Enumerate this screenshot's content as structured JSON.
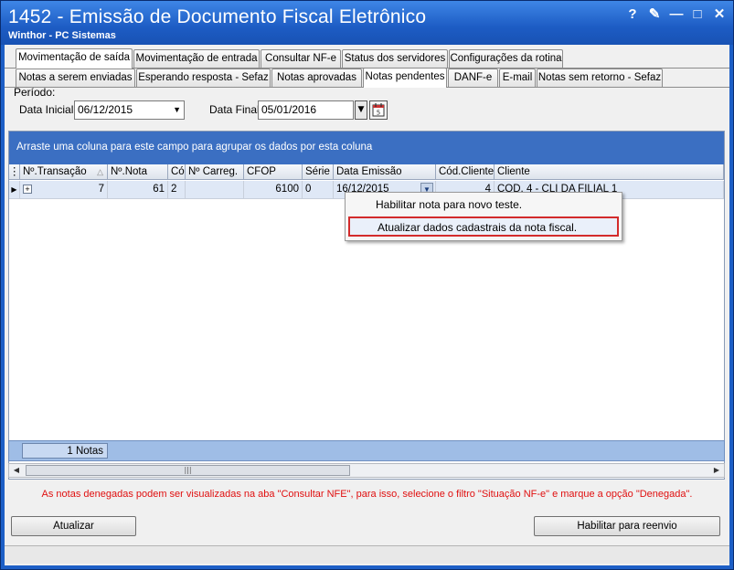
{
  "window": {
    "title": "1452 - Emissão de Documento Fiscal Eletrônico",
    "subtitle": "Winthor - PC Sistemas",
    "controls": [
      "?",
      "✎",
      "—",
      "□",
      "✕"
    ]
  },
  "tabs_top": [
    {
      "label": "Movimentação de saída",
      "active": true
    },
    {
      "label": "Movimentação de entrada",
      "active": false
    },
    {
      "label": "Consultar NF-e",
      "active": false
    },
    {
      "label": "Status dos servidores",
      "active": false
    },
    {
      "label": "Configurações da rotina",
      "active": false
    }
  ],
  "tabs_sub": [
    {
      "label": "Notas a serem enviadas",
      "active": false
    },
    {
      "label": "Esperando resposta - Sefaz",
      "active": false
    },
    {
      "label": "Notas aprovadas",
      "active": false
    },
    {
      "label": "Notas pendentes",
      "active": true
    },
    {
      "label": "DANF-e",
      "active": false
    },
    {
      "label": "E-mail",
      "active": false
    },
    {
      "label": "Notas sem retorno - Sefaz",
      "active": false
    }
  ],
  "period": {
    "label": "Período:",
    "start_label": "Data Inicial",
    "start_value": "06/12/2015",
    "end_label": "Data Final",
    "end_value": "05/01/2016"
  },
  "grid": {
    "group_hint": "Arraste uma coluna para este campo para agrupar os dados por esta coluna",
    "columns": [
      "Nº.Transação",
      "Nº.Nota",
      "Cód",
      "Nº Carreg.",
      "CFOP",
      "Série",
      "Data Emissão",
      "Cód.Cliente",
      "Cliente"
    ],
    "row": {
      "transacao": "7",
      "nota": "61",
      "cod": "2",
      "carreg": "",
      "cfop": "6100",
      "serie": "0",
      "data_emissao": "16/12/2015",
      "cod_cliente": "4",
      "cliente": "COD. 4 - CLI DA FILIAL 1"
    },
    "footer_count": "1 Notas"
  },
  "context_menu": [
    {
      "label": "Habilitar nota para novo teste.",
      "highlighted": false
    },
    {
      "label": "Atualizar dados cadastrais da nota fiscal.",
      "highlighted": true
    }
  ],
  "notice": "As notas denegadas podem ser visualizadas na aba \"Consultar NFE\", para isso, selecione o filtro \"Situação NF-e\" e marque a opção \"Denegada\".",
  "buttons": {
    "refresh": "Atualizar",
    "resend": "Habilitar para reenvio"
  },
  "colors": {
    "title_bar": "#1d5cc4",
    "group_bar": "#3b6fc2",
    "notice": "#e01010",
    "highlight_border": "#d32b2b"
  }
}
